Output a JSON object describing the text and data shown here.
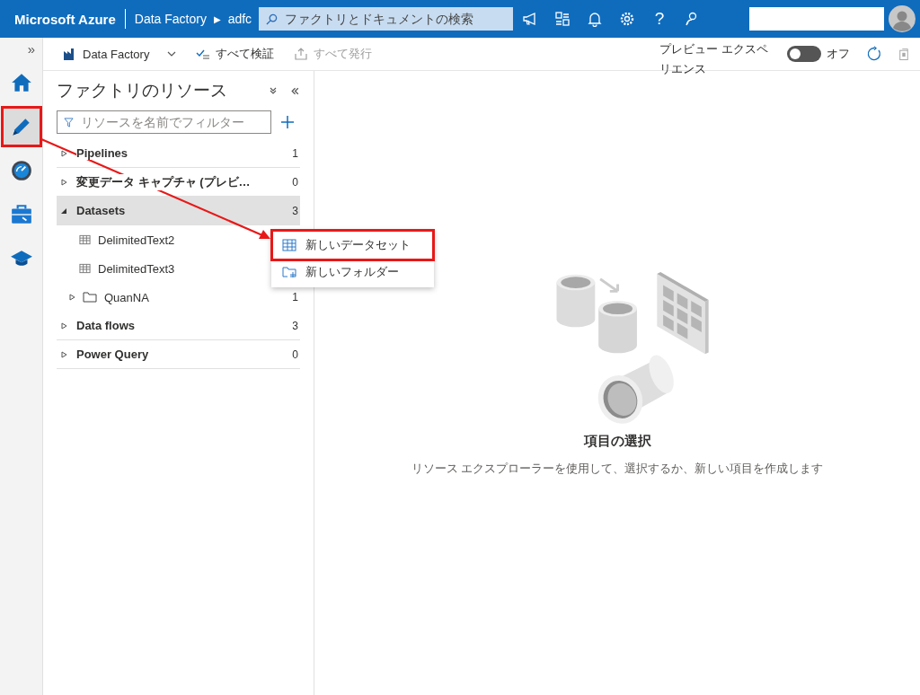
{
  "header": {
    "brand": "Microsoft Azure",
    "breadcrumb": [
      "Data Factory",
      "adfc"
    ],
    "breadcrumb_separator": "▶",
    "search": {
      "placeholder": "ファクトリとドキュメントの検索"
    },
    "help": "?"
  },
  "toolbar": {
    "factory": "Data Factory",
    "validate": {
      "label": "すべて検証",
      "disabled": false
    },
    "publish": {
      "label": "すべて発行",
      "disabled": true
    },
    "preview_label": "プレビュー エクスペリエンス",
    "preview_toggle": {
      "on": false,
      "label": "オフ"
    }
  },
  "rail": {
    "expand": "»",
    "items": [
      {
        "kind": "home",
        "selected": false,
        "highlighted": false
      },
      {
        "kind": "author",
        "selected": true,
        "highlighted": true
      },
      {
        "kind": "monitor",
        "selected": false,
        "highlighted": false
      },
      {
        "kind": "manage",
        "selected": false,
        "highlighted": false
      },
      {
        "kind": "learn",
        "selected": false,
        "highlighted": false
      }
    ]
  },
  "resources": {
    "title": "ファクトリのリソース",
    "filter": {
      "placeholder": "リソースを名前でフィルター"
    },
    "tree": [
      {
        "name": "Pipelines",
        "count": "1",
        "expanded": false,
        "selected": false
      },
      {
        "name": "変更データ キャプチャ (プレビ…",
        "count": "0",
        "expanded": false,
        "selected": false
      },
      {
        "name": "Datasets",
        "count": "3",
        "expanded": true,
        "selected": true,
        "children": [
          {
            "kind": "dataset",
            "name": "DelimitedText2"
          },
          {
            "kind": "dataset",
            "name": "DelimitedText3"
          },
          {
            "kind": "folder",
            "name": "QuanNA",
            "count": "1",
            "expanded": false
          }
        ]
      },
      {
        "name": "Data flows",
        "count": "3",
        "expanded": false,
        "selected": false
      },
      {
        "name": "Power Query",
        "count": "0",
        "expanded": false,
        "selected": false
      }
    ]
  },
  "context_menu": [
    {
      "kind": "dataset",
      "label": "新しいデータセット",
      "highlighted": true
    },
    {
      "kind": "folder",
      "label": "新しいフォルダー",
      "highlighted": false
    }
  ],
  "empty_state": {
    "title": "項目の選択",
    "description": "リソース エクスプローラーを使用して、選択するか、新しい項目を作成します"
  }
}
